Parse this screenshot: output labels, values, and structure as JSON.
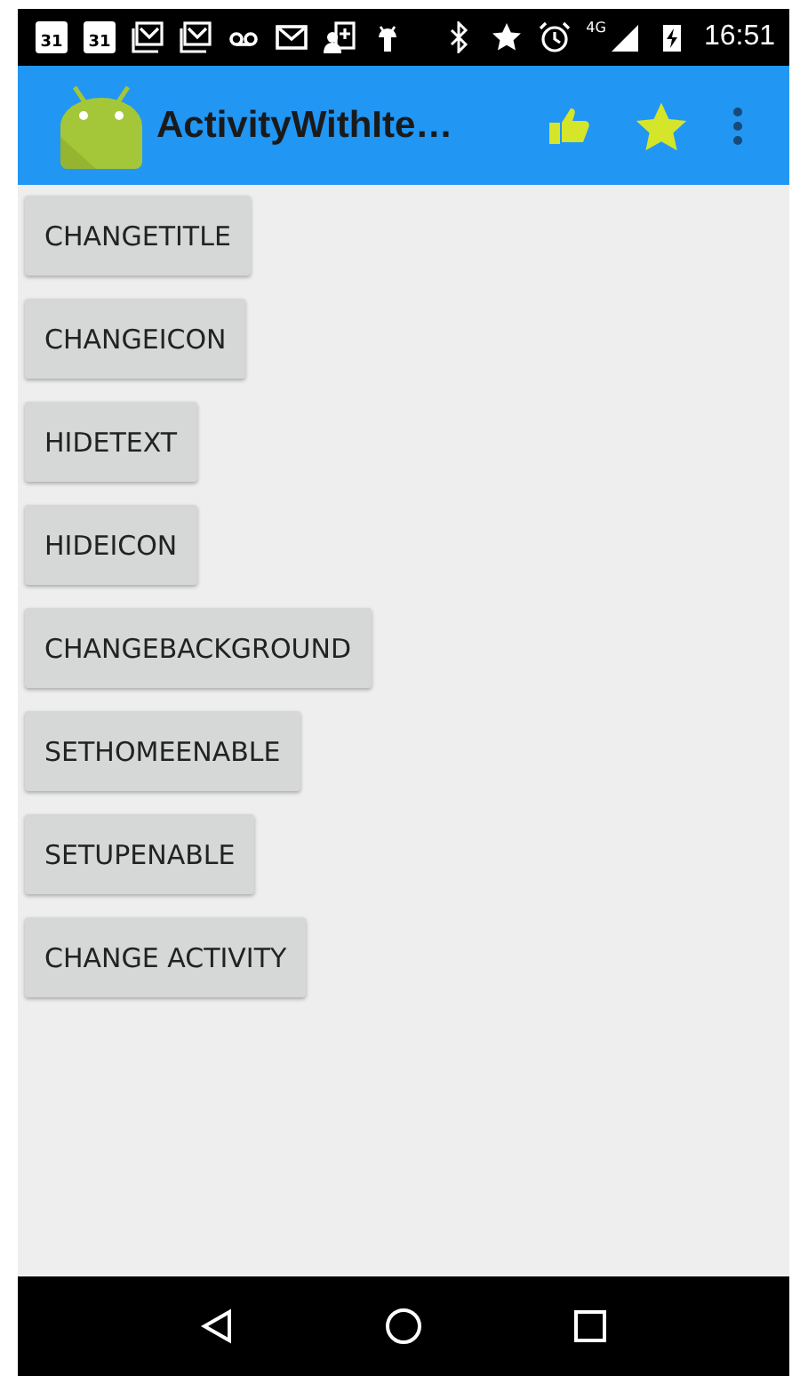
{
  "status_bar": {
    "calendar_dates": [
      "31",
      "31"
    ],
    "network": "4G",
    "time": "16:51"
  },
  "app_bar": {
    "title": "ActivityWithIte…"
  },
  "buttons": [
    "CHANGETITLE",
    "CHANGEICON",
    "HIDETEXT",
    "HIDEICON",
    "CHANGEBACKGROUND",
    "SETHOMEENABLE",
    "SETUPENABLE",
    "CHANGE ACTIVITY"
  ]
}
